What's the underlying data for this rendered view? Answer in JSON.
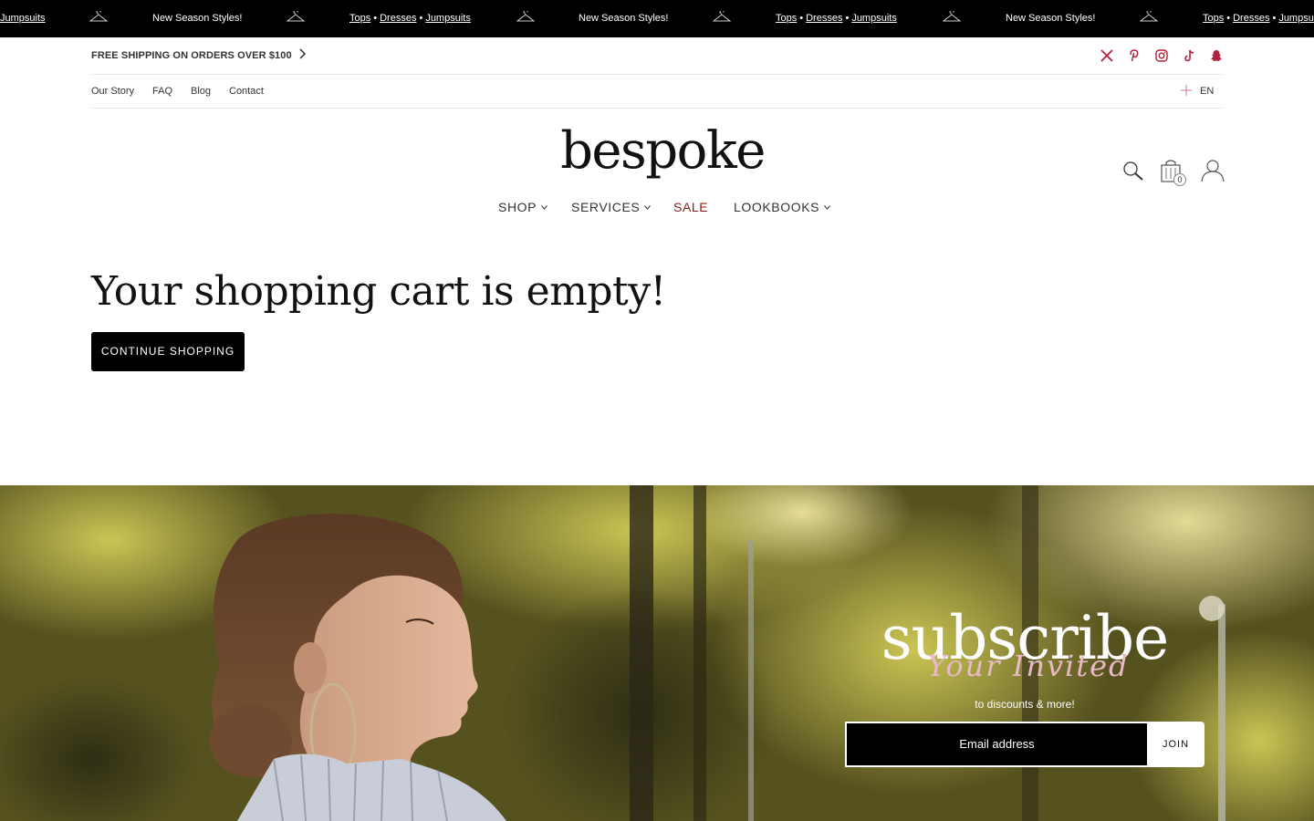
{
  "announcement": {
    "promo": "New Season Styles!",
    "categories": [
      "Tops",
      "Dresses",
      "Jumpsuits"
    ],
    "separator": "•",
    "partial_left": "Jumpsuits",
    "partial_right_prefix": "Tops",
    "partial_right_dresses": "Dresses",
    "partial_right_tail": "Jumpsu"
  },
  "utility": {
    "shipping": "FREE SHIPPING ON ORDERS OVER $100",
    "social_icons": [
      "x-icon",
      "pinterest-icon",
      "instagram-icon",
      "tiktok-icon",
      "snapchat-icon"
    ],
    "social_color": "#b0213b"
  },
  "secondary_nav": {
    "links": [
      "Our Story",
      "FAQ",
      "Blog",
      "Contact"
    ],
    "language": "EN"
  },
  "header": {
    "logo": "bespoke",
    "cart_count": "0"
  },
  "main_nav": {
    "items": [
      {
        "label": "SHOP",
        "has_dropdown": true
      },
      {
        "label": "SERVICES",
        "has_dropdown": true
      },
      {
        "label": "SALE",
        "has_dropdown": false
      },
      {
        "label": "LOOKBOOKS",
        "has_dropdown": true
      }
    ],
    "sale_color": "#8b1a1a"
  },
  "cart": {
    "title": "Your shopping cart is empty!",
    "continue_label": "CONTINUE SHOPPING"
  },
  "subscribe": {
    "title": "subscribe",
    "script": "Your Invited",
    "text": "to discounts & more!",
    "email_placeholder": "Email address",
    "join_label": "JOIN"
  }
}
